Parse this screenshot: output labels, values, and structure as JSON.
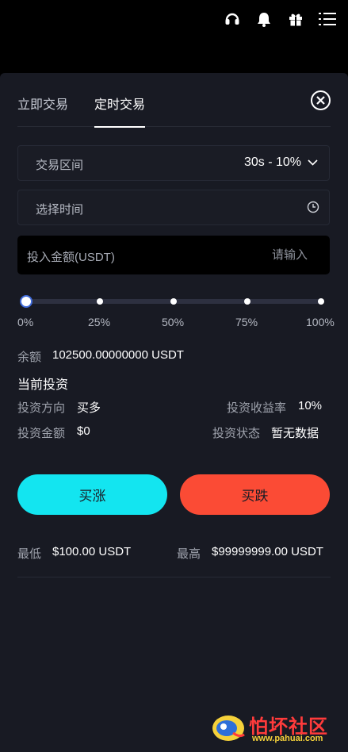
{
  "header": {
    "icons": [
      "headset-icon",
      "bell-icon",
      "gift-icon",
      "menu-icon"
    ],
    "peek_left": "",
    "peek_mid": "",
    "peek_right": ""
  },
  "tabs": [
    {
      "label": "立即交易",
      "active": false
    },
    {
      "label": "定时交易",
      "active": true
    }
  ],
  "form": {
    "range_label": "交易区间",
    "range_value": "30s - 10%",
    "time_label": "选择时间",
    "amount_label": "投入金额(USDT)",
    "amount_placeholder": "请输入",
    "slider_value_percent": 0,
    "slider_marks": [
      "0%",
      "25%",
      "50%",
      "75%",
      "100%"
    ]
  },
  "balance": {
    "label": "余额",
    "value": "102500.00000000 USDT"
  },
  "investment": {
    "title": "当前投资",
    "direction_label": "投资方向",
    "direction_value": "买多",
    "return_label": "投资收益率",
    "return_value": "10%",
    "amount_label": "投资金额",
    "amount_value": "$0",
    "status_label": "投资状态",
    "status_value": "暂无数据"
  },
  "buttons": {
    "buy_up": "买涨",
    "buy_down": "买跌"
  },
  "limits": {
    "min_label": "最低",
    "min_value": "$100.00 USDT",
    "max_label": "最高",
    "max_value": "$99999999.00 USDT"
  },
  "watermark": {
    "title": "怕坏社区",
    "url": "www.pahuai.com"
  },
  "colors": {
    "background": "#181a23",
    "buy_up": "#13e5f0",
    "buy_down": "#fb4b35"
  }
}
